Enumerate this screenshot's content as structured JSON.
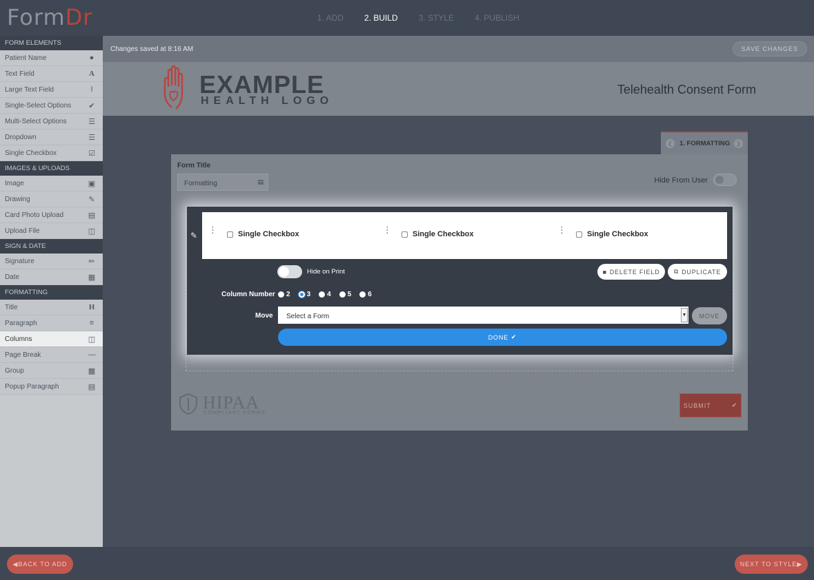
{
  "brand": {
    "part1": "Form",
    "part2": "Dr"
  },
  "steps": [
    "1. ADD",
    "2. BUILD",
    "3. STYLE",
    "4. PUBLISH"
  ],
  "sidebar": {
    "sections": [
      {
        "title": "FORM ELEMENTS",
        "items": [
          {
            "label": "Patient Name",
            "icon": "user-icon"
          },
          {
            "label": "Text Field",
            "icon": "letter-a-icon"
          },
          {
            "label": "Large Text Field",
            "icon": "text-cursor-icon"
          },
          {
            "label": "Single-Select Options",
            "icon": "check-circle-icon"
          },
          {
            "label": "Multi-Select Options",
            "icon": "list-icon"
          },
          {
            "label": "Dropdown",
            "icon": "list-icon"
          },
          {
            "label": "Single Checkbox",
            "icon": "checkbox-icon"
          }
        ]
      },
      {
        "title": "IMAGES & UPLOADS",
        "items": [
          {
            "label": "Image",
            "icon": "image-icon"
          },
          {
            "label": "Drawing",
            "icon": "edit-icon"
          },
          {
            "label": "Card Photo Upload",
            "icon": "id-card-icon"
          },
          {
            "label": "Upload File",
            "icon": "file-icon"
          }
        ]
      },
      {
        "title": "SIGN & DATE",
        "items": [
          {
            "label": "Signature",
            "icon": "pen-icon"
          },
          {
            "label": "Date",
            "icon": "calendar-icon"
          }
        ]
      },
      {
        "title": "FORMATTING",
        "items": [
          {
            "label": "Title",
            "icon": "heading-icon"
          },
          {
            "label": "Paragraph",
            "icon": "align-left-icon"
          },
          {
            "label": "Columns",
            "icon": "columns-icon"
          },
          {
            "label": "Page Break",
            "icon": "minus-icon"
          },
          {
            "label": "Group",
            "icon": "group-icon"
          },
          {
            "label": "Popup Paragraph",
            "icon": "window-icon"
          }
        ]
      }
    ]
  },
  "status": {
    "text": "Changes saved at 8:16 AM",
    "save_label": "SAVE CHANGES"
  },
  "header": {
    "logo_line1": "EXAMPLE",
    "logo_line2": "HEALTH LOGO",
    "form_name": "Telehealth Consent Form"
  },
  "tab": {
    "label": "1. FORMATTING"
  },
  "panel": {
    "title_label": "Form Title",
    "title_value": "Formatting",
    "hide_from_user": "Hide From User"
  },
  "editor": {
    "columns": [
      "Single Checkbox",
      "Single Checkbox",
      "Single Checkbox"
    ],
    "hide_on_print": "Hide on Print",
    "delete_label": "DELETE FIELD",
    "duplicate_label": "DUPLICATE",
    "column_number_label": "Column Number",
    "column_options": [
      "2",
      "3",
      "4",
      "5",
      "6"
    ],
    "column_selected": "3",
    "move_label": "Move",
    "move_select_value": "Select a Form",
    "move_button": "MOVE",
    "done_label": "DONE"
  },
  "hipaa": {
    "big": "HIPAA",
    "small": "COMPLIANT FORMS"
  },
  "submit_label": "SUBMIT",
  "footer": {
    "back_label": "BACK TO ADD",
    "next_label": "NEXT TO STYLE"
  },
  "colors": {
    "accent": "#c1574f",
    "blue": "#2d8ee6",
    "dark": "#3e4753"
  }
}
